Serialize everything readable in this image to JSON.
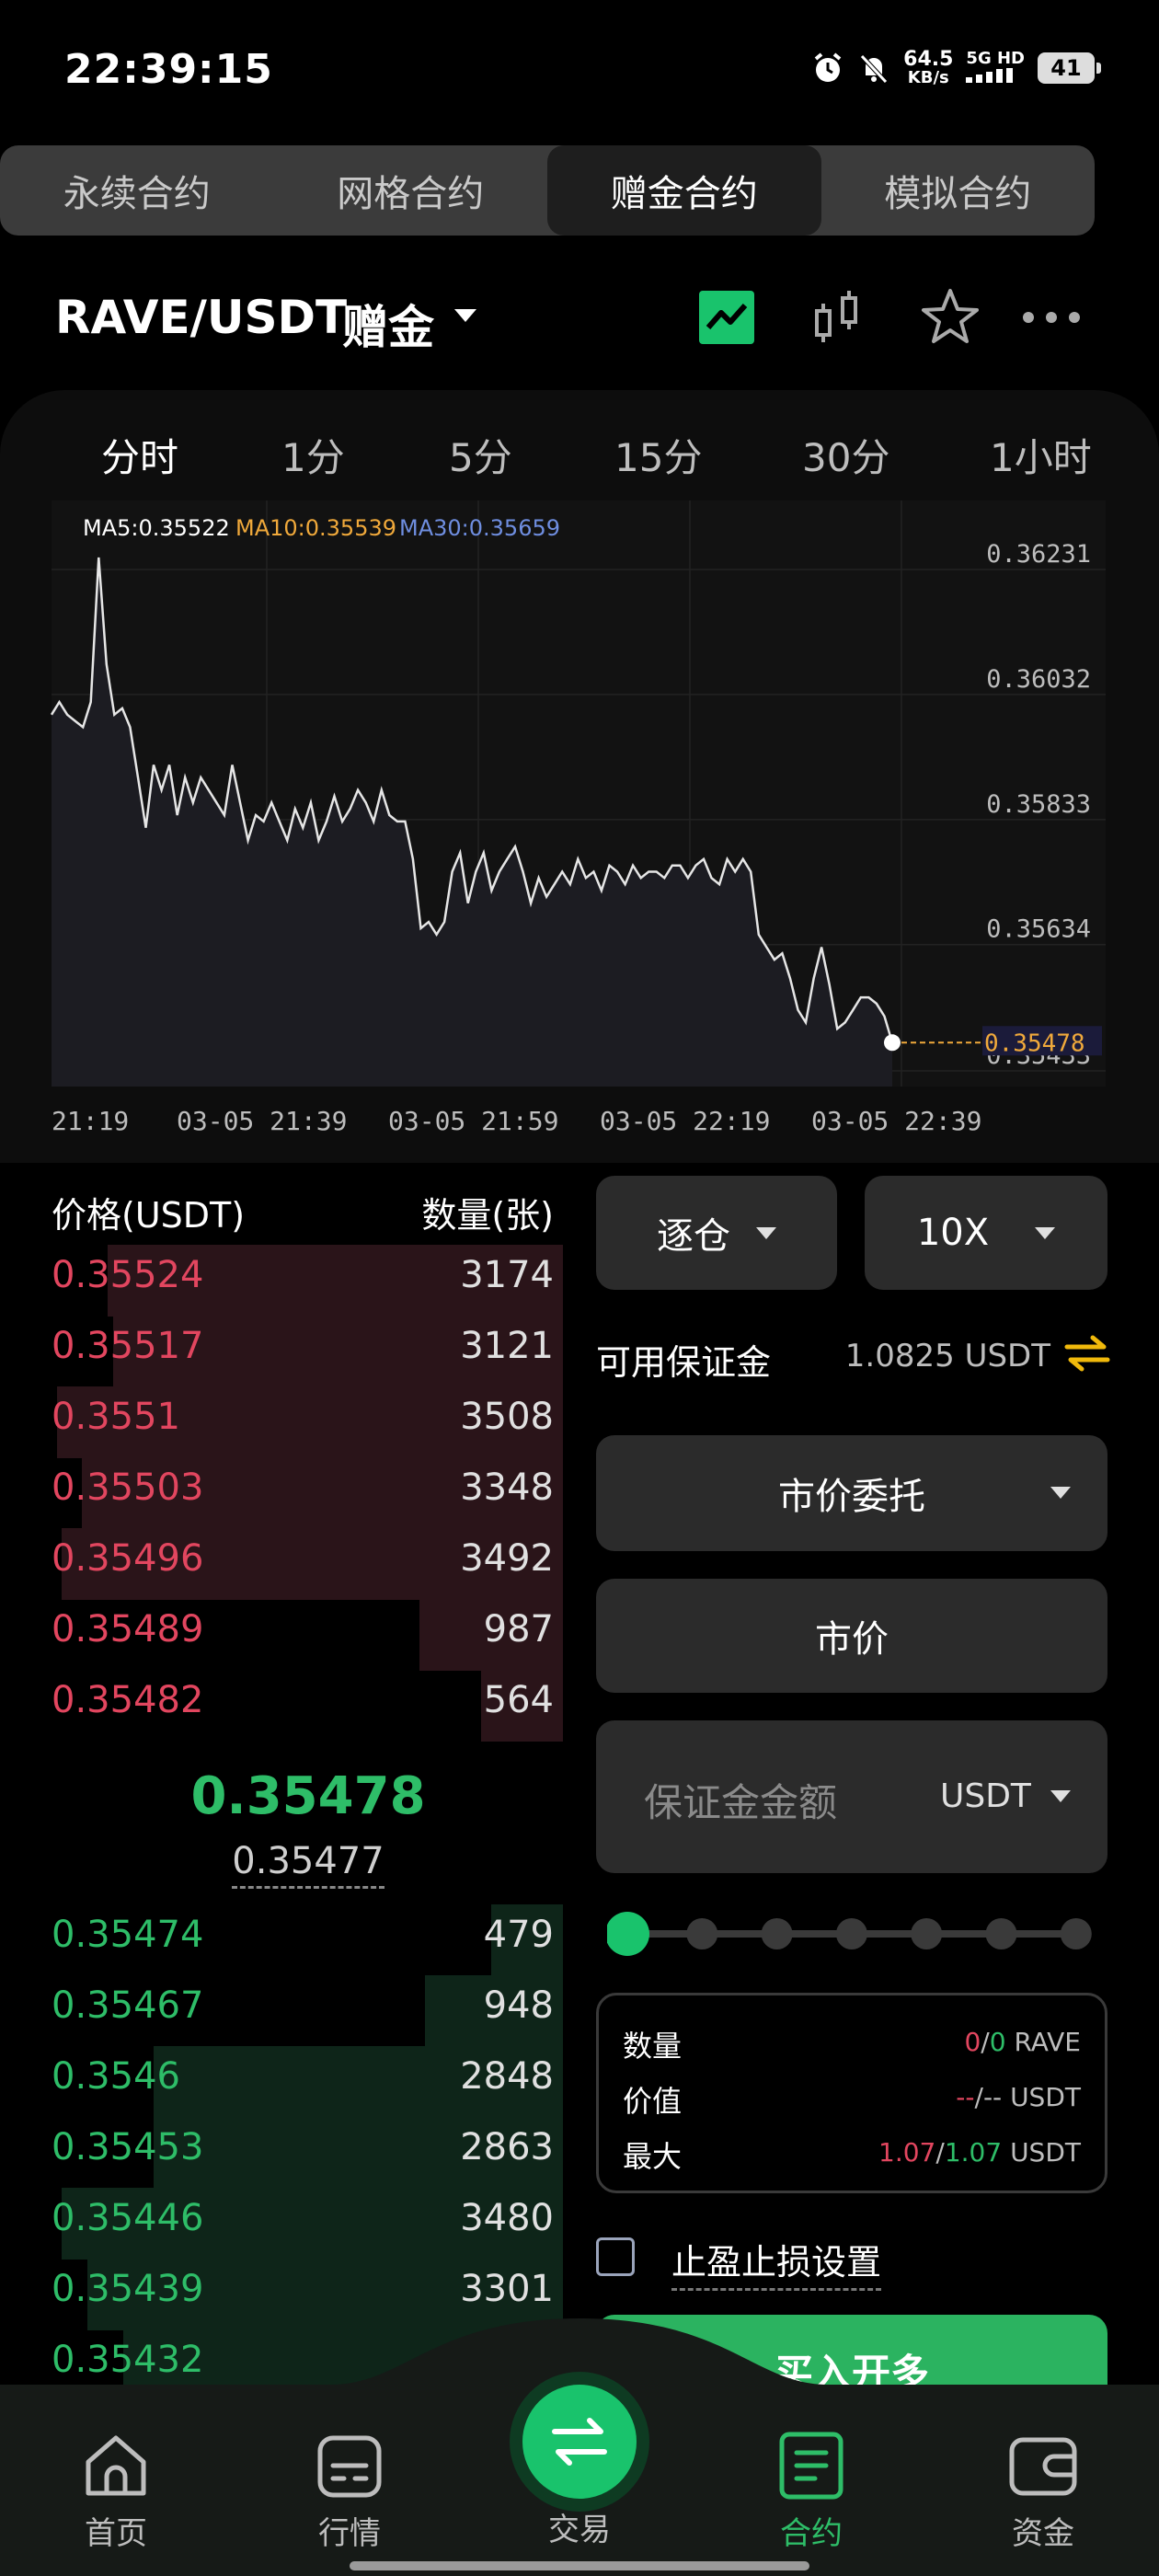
{
  "status_bar": {
    "time": "22:39:15",
    "net_speed": "64.5",
    "net_unit": "KB/s",
    "net_type": "5G HD",
    "battery": "41"
  },
  "contract_tabs": [
    {
      "label": "永续合约",
      "active": false
    },
    {
      "label": "网格合约",
      "active": false
    },
    {
      "label": "赠金合约",
      "active": true
    },
    {
      "label": "模拟合约",
      "active": false
    }
  ],
  "header": {
    "pair": "RAVE/USDT",
    "tag": "赠金",
    "icons": [
      "line-chart-icon",
      "candlestick-icon",
      "star-icon",
      "more-icon"
    ]
  },
  "time_tabs": [
    {
      "label": "分时",
      "active": true
    },
    {
      "label": "1分",
      "active": false
    },
    {
      "label": "5分",
      "active": false
    },
    {
      "label": "15分",
      "active": false
    },
    {
      "label": "30分",
      "active": false
    },
    {
      "label": "1小时",
      "active": false
    }
  ],
  "chart_data": {
    "type": "line",
    "ma_labels": {
      "ma5": "MA5:0.35522",
      "ma10": "MA10:0.35539",
      "ma30": "MA30:0.35659"
    },
    "ma_colors": {
      "ma5": "#ffffff",
      "ma10": "#f0a93b",
      "ma30": "#6f8ee0"
    },
    "y_ticks": [
      "0.36231",
      "0.36032",
      "0.35833",
      "0.35634",
      "0.35433"
    ],
    "y_tick_values": [
      0.36231,
      0.36032,
      0.35833,
      0.35634,
      0.35433
    ],
    "ylim": [
      0.35433,
      0.36231
    ],
    "x_ticks": [
      "21:19",
      "03-05 21:39",
      "03-05 21:59",
      "03-05 22:19",
      "03-05 22:39"
    ],
    "last_price_label": "0.35478",
    "last_price": 0.35478,
    "series": [
      {
        "values": [
          0.36,
          0.3602,
          0.36,
          0.3599,
          0.3598,
          0.3602,
          0.3625,
          0.3608,
          0.36,
          0.3601,
          0.3598,
          0.359,
          0.3582,
          0.3592,
          0.3588,
          0.3592,
          0.3584,
          0.359,
          0.3586,
          0.359,
          0.3588,
          0.3586,
          0.3584,
          0.3592,
          0.3586,
          0.358,
          0.3584,
          0.3583,
          0.3586,
          0.3583,
          0.358,
          0.3585,
          0.3582,
          0.3586,
          0.358,
          0.3583,
          0.3587,
          0.3583,
          0.3585,
          0.3588,
          0.3586,
          0.3583,
          0.3588,
          0.3584,
          0.3583,
          0.3583,
          0.3577,
          0.3566,
          0.3567,
          0.3565,
          0.3567,
          0.3575,
          0.3578,
          0.357,
          0.3575,
          0.3578,
          0.3572,
          0.3575,
          0.3577,
          0.3579,
          0.3575,
          0.357,
          0.3574,
          0.3571,
          0.3573,
          0.3575,
          0.3573,
          0.3577,
          0.3574,
          0.3575,
          0.3572,
          0.3576,
          0.3575,
          0.3573,
          0.3576,
          0.3574,
          0.3575,
          0.3575,
          0.3574,
          0.3576,
          0.3576,
          0.3574,
          0.3576,
          0.3577,
          0.3574,
          0.3573,
          0.3577,
          0.3575,
          0.3577,
          0.3575,
          0.3565,
          0.3563,
          0.3561,
          0.3562,
          0.3558,
          0.3553,
          0.3551,
          0.3558,
          0.3563,
          0.3557,
          0.355,
          0.3551,
          0.3553,
          0.3555,
          0.3555,
          0.3554,
          0.3552,
          0.35478
        ]
      }
    ]
  },
  "order_book": {
    "header_price": "价格(USDT)",
    "header_qty": "数量(张)",
    "asks": [
      {
        "price": "0.35524",
        "qty": "3174",
        "depth": 0.89
      },
      {
        "price": "0.35517",
        "qty": "3121",
        "depth": 0.88
      },
      {
        "price": "0.3551",
        "qty": "3508",
        "depth": 0.99
      },
      {
        "price": "0.35503",
        "qty": "3348",
        "depth": 0.94
      },
      {
        "price": "0.35496",
        "qty": "3492",
        "depth": 0.98
      },
      {
        "price": "0.35489",
        "qty": "987",
        "depth": 0.28
      },
      {
        "price": "0.35482",
        "qty": "564",
        "depth": 0.16
      }
    ],
    "mid_price": "0.35478",
    "mark_price": "0.35477",
    "bids": [
      {
        "price": "0.35474",
        "qty": "479",
        "depth": 0.14
      },
      {
        "price": "0.35467",
        "qty": "948",
        "depth": 0.27
      },
      {
        "price": "0.3546",
        "qty": "2848",
        "depth": 0.8
      },
      {
        "price": "0.35453",
        "qty": "2863",
        "depth": 0.8
      },
      {
        "price": "0.35446",
        "qty": "3480",
        "depth": 0.98
      },
      {
        "price": "0.35439",
        "qty": "3301",
        "depth": 0.93
      },
      {
        "price": "0.35432",
        "qty": "",
        "depth": 0.86
      }
    ]
  },
  "order_form": {
    "margin_mode": "逐仓",
    "leverage": "10X",
    "available_label": "可用保证金",
    "available_value": "1.0825 USDT",
    "order_type": "市价委托",
    "price_mode": "市价",
    "amount_placeholder": "保证金金额",
    "amount_unit": "USDT",
    "slider_level": 0,
    "summary": {
      "qty_label": "数量",
      "qty_a": "0",
      "qty_b": "0",
      "qty_unit": "RAVE",
      "value_label": "价值",
      "value_a": "--",
      "value_b": "--",
      "value_unit": "USDT",
      "max_label": "最大",
      "max_a": "1.07",
      "max_b": "1.07",
      "max_unit": "USDT"
    },
    "tpsl_label": "止盈止损设置",
    "buy_label": "买入开多"
  },
  "bottom_nav": [
    {
      "label": "首页",
      "icon": "home-icon",
      "active": false
    },
    {
      "label": "行情",
      "icon": "market-icon",
      "active": false
    },
    {
      "label": "交易",
      "icon": "swap-icon",
      "active": false
    },
    {
      "label": "合约",
      "icon": "contract-icon",
      "active": true
    },
    {
      "label": "资金",
      "icon": "wallet-icon",
      "active": false
    }
  ]
}
